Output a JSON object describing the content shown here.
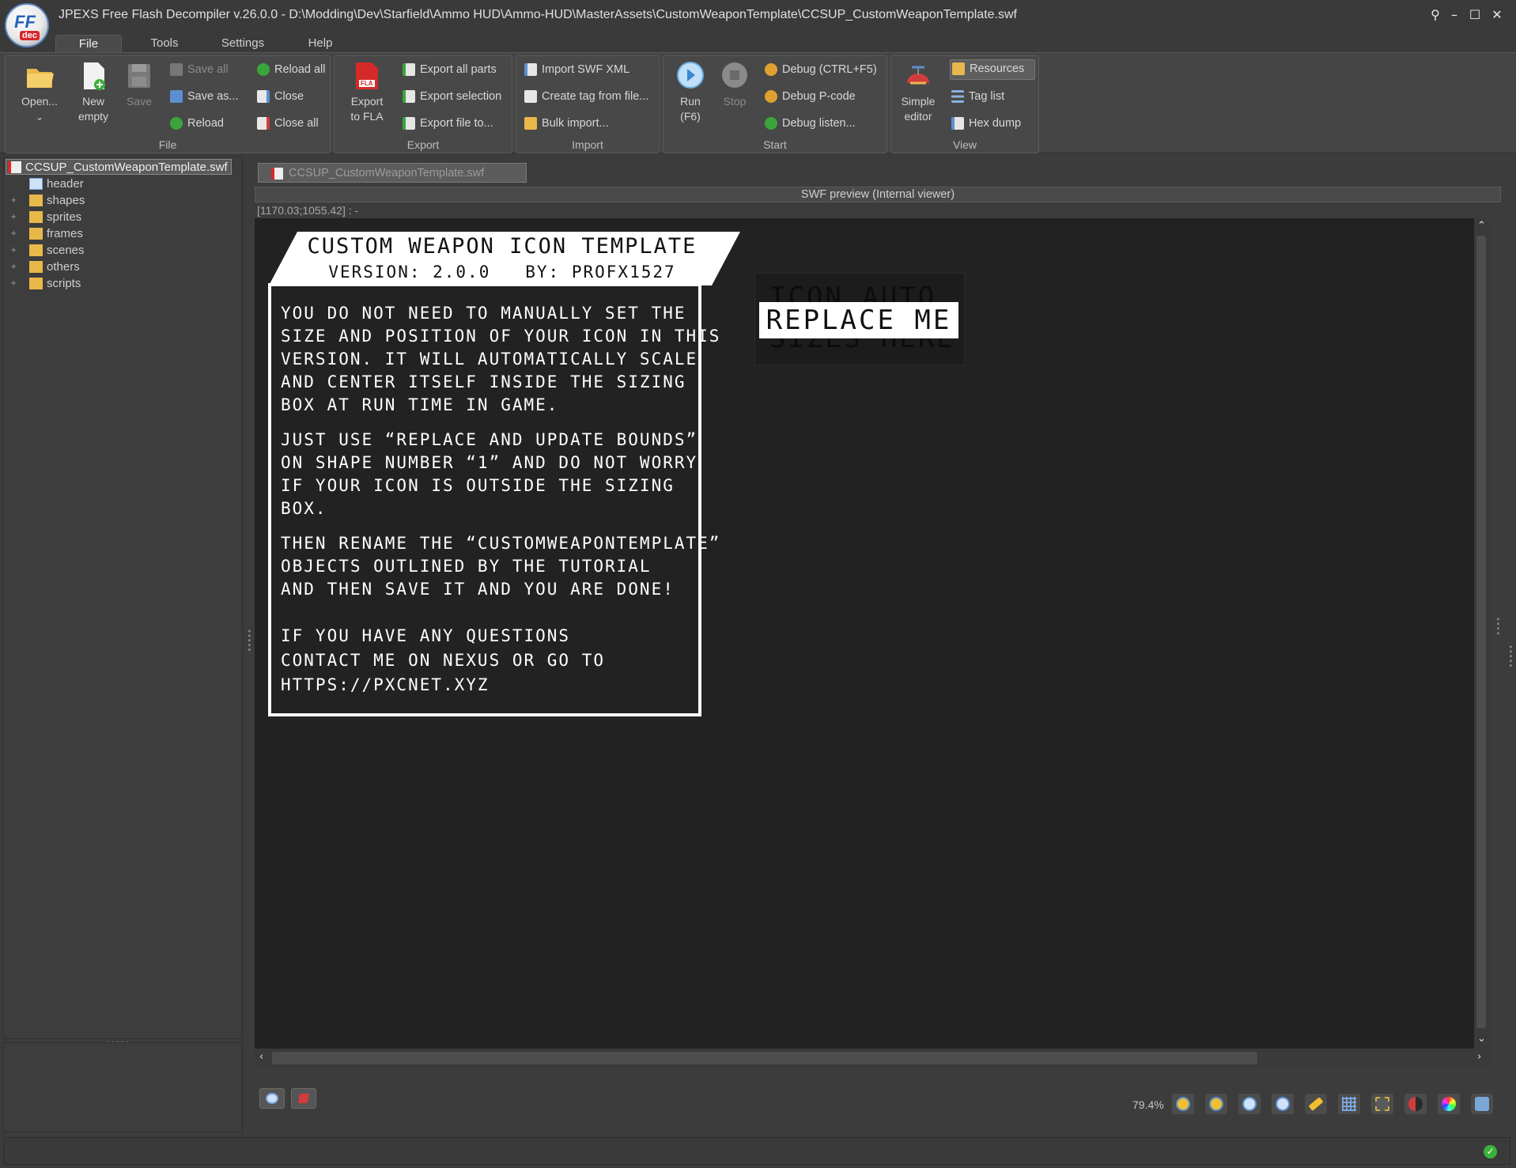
{
  "window": {
    "title": "JPEXS Free Flash Decompiler v.26.0.0 - D:\\Modding\\Dev\\Starfield\\Ammo HUD\\Ammo-HUD\\MasterAssets\\CustomWeaponTemplate\\CCSUP_CustomWeaponTemplate.swf",
    "logo_text": "FF",
    "logo_sub": "dec"
  },
  "menu": [
    "File",
    "Tools",
    "Settings",
    "Help"
  ],
  "ribbon": {
    "file": {
      "label": "File",
      "open": "Open...",
      "new_line1": "New",
      "new_line2": "empty",
      "save": "Save",
      "save_all": "Save all",
      "save_as": "Save as...",
      "reload": "Reload",
      "reload_all": "Reload all",
      "close": "Close",
      "close_all": "Close all"
    },
    "export": {
      "label": "Export",
      "fla_line1": "Export",
      "fla_line2": "to FLA",
      "fla_badge": "FLA",
      "all_parts": "Export all parts",
      "selection": "Export selection",
      "file_to": "Export file to..."
    },
    "import": {
      "label": "Import",
      "swf_xml": "Import SWF XML",
      "tag_from_file": "Create tag from file...",
      "bulk": "Bulk import..."
    },
    "start": {
      "label": "Start",
      "run_line1": "Run",
      "run_line2": "(F6)",
      "stop": "Stop",
      "debug": "Debug (CTRL+F5)",
      "debug_pcode": "Debug P-code",
      "debug_listen": "Debug listen..."
    },
    "view": {
      "label": "View",
      "simple_line1": "Simple",
      "simple_line2": "editor",
      "resources": "Resources",
      "tag_list": "Tag list",
      "hex_dump": "Hex dump"
    }
  },
  "tree": {
    "root": "CCSUP_CustomWeaponTemplate.swf",
    "items": [
      "header",
      "shapes",
      "sprites",
      "frames",
      "scenes",
      "others",
      "scripts"
    ]
  },
  "document_tab": "CCSUP_CustomWeaponTemplate.swf",
  "preview": {
    "header": "SWF preview (Internal viewer)",
    "coords": "[1170.03;1055.42] :  -",
    "zoom": "79.4%"
  },
  "swf": {
    "title": "CUSTOM WEAPON ICON TEMPLATE",
    "subtitle": "VERSION: 2.0.0   BY: PROFX1527",
    "paragraph1": [
      "YOU DO NOT NEED TO MANUALLY SET THE",
      "SIZE AND POSITION OF YOUR ICON IN THIS",
      "VERSION. IT WILL AUTOMATICALLY SCALE",
      "AND CENTER ITSELF INSIDE THE SIZING",
      "BOX AT RUN TIME IN GAME."
    ],
    "paragraph2": [
      "JUST USE “REPLACE AND UPDATE BOUNDS”",
      "ON SHAPE NUMBER “1” AND DO NOT WORRY",
      "IF YOUR ICON IS OUTSIDE THE SIZING",
      "BOX."
    ],
    "paragraph3": [
      "THEN RENAME THE “CUSTOMWEAPONTEMPLATE”",
      "OBJECTS OUTLINED BY THE TUTORIAL",
      "AND THEN SAVE IT AND YOU ARE DONE!"
    ],
    "paragraph4": [
      "IF YOU HAVE ANY QUESTIONS",
      "CONTACT ME ON NEXUS OR GO TO",
      "HTTPS://PXCNET.XYZ"
    ],
    "icon_bg_line1": "ICON AUTO",
    "icon_bg_line2": "SIZES HERE",
    "replace_me": "REPLACE ME"
  }
}
